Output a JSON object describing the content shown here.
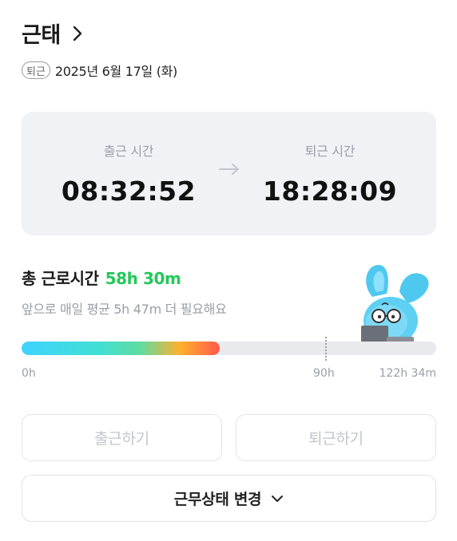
{
  "header": {
    "title": "근태"
  },
  "date_row": {
    "status_badge": "퇴근",
    "date": "2025년 6월 17일 (화)"
  },
  "times": {
    "clock_in_label": "출근 시간",
    "clock_in_value": "08:32:52",
    "clock_out_label": "퇴근 시간",
    "clock_out_value": "18:28:09"
  },
  "total": {
    "label": "총 근로시간",
    "value": "58h 30m",
    "needed_text": "앞으로 매일 평균 5h 47m 더 필요해요"
  },
  "progress": {
    "fraction": 0.477,
    "marker_fraction": 0.733,
    "tick_start": "0h",
    "tick_marker": "90h",
    "tick_end": "122h 34m"
  },
  "buttons": {
    "clock_in": "출근하기",
    "clock_out": "퇴근하기",
    "change_status": "근무상태 변경"
  },
  "colors": {
    "accent_green": "#23c85a",
    "card_bg": "#f1f2f6",
    "muted_text": "#9a9ea6"
  },
  "icons": {
    "header_chevron": "chevron-right-icon",
    "time_arrow": "arrow-right-icon",
    "status_chevron": "chevron-down-icon",
    "mascot": "rabbit-mascot-illustration"
  }
}
